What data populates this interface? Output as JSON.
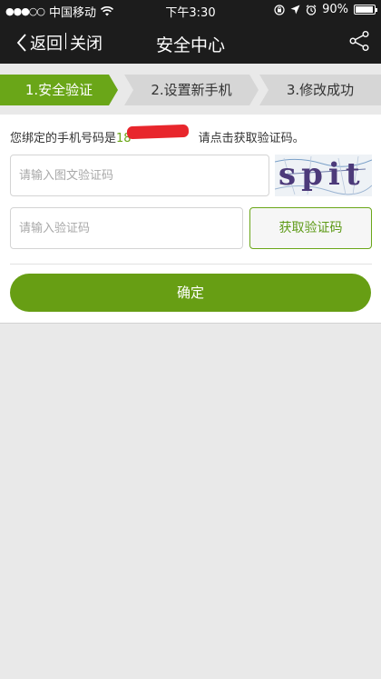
{
  "status_bar": {
    "signal": "●●●○○",
    "carrier": "中国移动",
    "time": "下午3:30",
    "battery": "90%"
  },
  "nav": {
    "back_label": "返回",
    "close_label": "关闭",
    "title": "安全中心"
  },
  "steps": [
    {
      "label": "1.安全验证",
      "active": true
    },
    {
      "label": "2.设置新手机",
      "active": false
    },
    {
      "label": "3.修改成功",
      "active": false
    }
  ],
  "form": {
    "bound_phone_prefix": "您绑定的手机号码是",
    "bound_phone_visible": "18",
    "bound_phone_suffix": "请点击获取验证码。",
    "captcha_placeholder": "请输入图文验证码",
    "captcha_text": "spit",
    "sms_placeholder": "请输入验证码",
    "get_code_label": "获取验证码",
    "confirm_label": "确定"
  },
  "colors": {
    "accent": "#6aa618",
    "nav_bg": "#1c1c1c",
    "page_bg": "#e9e9e9",
    "redaction": "#e8262c"
  }
}
